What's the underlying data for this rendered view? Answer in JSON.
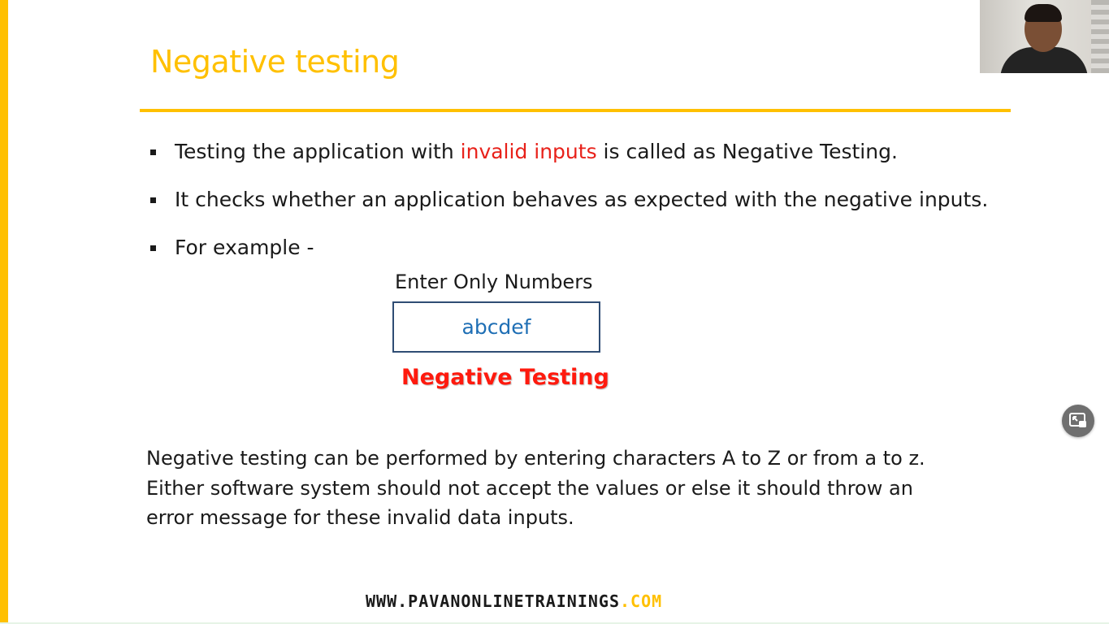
{
  "slide": {
    "title": "Negative testing",
    "bullets": [
      {
        "before": "Testing the application with ",
        "highlight": "invalid inputs",
        "after": " is called as Negative Testing."
      },
      {
        "text": "It checks whether an application behaves as expected with the negative inputs."
      },
      {
        "text": "For example -"
      }
    ],
    "example": {
      "label": "Enter Only Numbers",
      "input_value": "abcdef",
      "result": "Negative Testing"
    },
    "paragraph": [
      "Negative testing can be performed by entering characters A to Z or from a to z.",
      "Either software system should not accept the values or else it should throw an",
      "error message for these invalid data inputs."
    ],
    "footer": {
      "site": "WWW.PAVANONLINETRAININGS",
      "tld": ".COM"
    }
  },
  "colors": {
    "accent": "#ffc000",
    "highlight": "#e8211a",
    "input_text": "#1f6fb5",
    "result": "#ff1a0e"
  },
  "overlay": {
    "webcam": "presenter-video",
    "pip_icon": "picture-in-picture-icon"
  }
}
